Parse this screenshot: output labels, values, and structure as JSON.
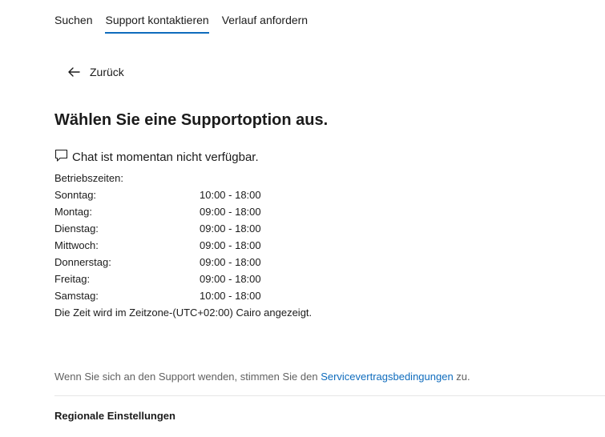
{
  "tabs": [
    {
      "label": "Suchen",
      "active": false
    },
    {
      "label": "Support kontaktieren",
      "active": true
    },
    {
      "label": "Verlauf anfordern",
      "active": false
    }
  ],
  "back": {
    "label": "Zurück",
    "icon": "arrow-left-icon"
  },
  "title": "Wählen Sie eine Supportoption aus.",
  "chat": {
    "icon": "chat-bubble-icon",
    "status": "Chat ist momentan nicht verfügbar."
  },
  "hours": {
    "heading": "Betriebszeiten:",
    "rows": [
      {
        "day": "Sonntag:",
        "time": "10:00 - 18:00"
      },
      {
        "day": "Montag:",
        "time": "09:00 - 18:00"
      },
      {
        "day": "Dienstag:",
        "time": "09:00 - 18:00"
      },
      {
        "day": "Mittwoch:",
        "time": "09:00 - 18:00"
      },
      {
        "day": "Donnerstag:",
        "time": "09:00 - 18:00"
      },
      {
        "day": "Freitag:",
        "time": "09:00 - 18:00"
      },
      {
        "day": "Samstag:",
        "time": "10:00 - 18:00"
      }
    ],
    "timezone_note": "Die Zeit wird im Zeitzone-(UTC+02:00) Cairo angezeigt."
  },
  "agreement": {
    "prefix": "Wenn Sie sich an den Support wenden, stimmen Sie den ",
    "link": "Servicevertragsbedingungen",
    "suffix": " zu."
  },
  "regional": {
    "label": "Regionale Einstellungen"
  },
  "colors": {
    "accent": "#0f6cbd",
    "muted_text": "#616161",
    "divider": "#e6e6e6"
  }
}
